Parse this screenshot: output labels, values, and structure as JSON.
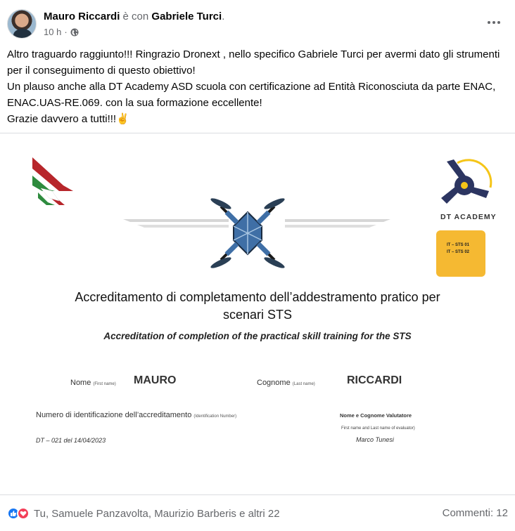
{
  "header": {
    "author": "Mauro Riccardi",
    "with_text": "è con",
    "tagged": "Gabriele Turci",
    "period": ".",
    "time": "10 h",
    "separator": "·"
  },
  "post": {
    "lines": [
      "Altro traguardo raggiunto!!! Ringrazio Dronext , nello specifico Gabriele Turci per avermi dato gli strumenti per il conseguimento di questo obiettivo!",
      "Un plauso anche alla DT Academy ASD scuola con certificazione ad Entità Riconosciuta da parte ENAC, ENAC.UAS-RE.069. con la sua formazione eccellente!",
      "Grazie davvero a tutti!!!✌️"
    ]
  },
  "certificate": {
    "title_line1": "Accreditamento di completamento dell’addestramento pratico per",
    "title_line2": "scenari STS",
    "subtitle": "Accreditation of completion of the practical skill training for the STS",
    "logo_text": "DT ACADEMY",
    "badge_line1": "IT – STS 01",
    "badge_line2": "IT – STS 02",
    "name_label": "Nome",
    "name_label_en": "(First name)",
    "name_value": "MAURO",
    "surname_label": "Cognome",
    "surname_label_en": "(Last name)",
    "surname_value": "RICCARDI",
    "id_label": "Numero di identificazione dell’accreditamento",
    "id_label_en": "(Identification Number)",
    "id_value": "DT – 021  del 14/04/2023",
    "evaluator_label": "Nome e Cognome Valutatore",
    "evaluator_label_en": "First name and Last name of evaluator)",
    "evaluator_value": "Marco Tunesi"
  },
  "footer": {
    "reactions_text": "Tu, Samuele Panzavolta, Maurizio Barberis e altri 22",
    "comments_text": "Commenti: 12"
  },
  "colors": {
    "like": "#1877f2",
    "love": "#f33e58",
    "badge": "#f5b932",
    "drone_blue": "#3f6fa6"
  },
  "icons": [
    "globe-icon",
    "more-icon",
    "like-icon",
    "love-icon",
    "drone-icon",
    "enac-logo-icon",
    "dt-academy-logo-icon"
  ]
}
